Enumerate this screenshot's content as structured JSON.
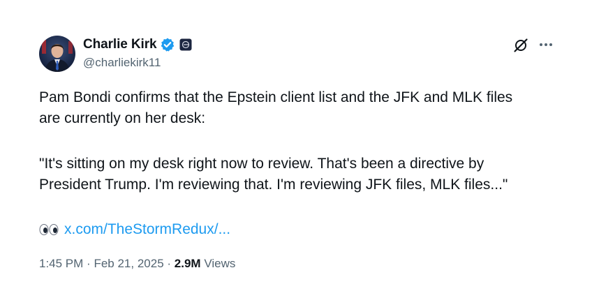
{
  "author": {
    "display_name": "Charlie Kirk",
    "handle": "@charliekirk11",
    "verified_color": "#1d9bf0"
  },
  "icons": {
    "verified": "verified-badge-icon",
    "affiliation": "affiliation-badge-icon",
    "grok": "grok-icon",
    "more": "more-icon",
    "eyes": "eyes-emoji-icon"
  },
  "tweet": {
    "lines": [
      "Pam Bondi confirms that the Epstein client list and the JFK and MLK files",
      "are currently on her desk:",
      "\"It's sitting on my desk right now to review. That's been a directive by",
      "President Trump. I'm reviewing that. I'm reviewing JFK files, MLK files...\""
    ],
    "link_text": "x.com/TheStormRedux/..."
  },
  "meta": {
    "time": "1:45 PM",
    "separator": "·",
    "date": "Feb 21, 2025",
    "views_count": "2.9M",
    "views_label": "Views"
  },
  "colors": {
    "text": "#0f1419",
    "secondary": "#536471",
    "link": "#1d9bf0"
  }
}
